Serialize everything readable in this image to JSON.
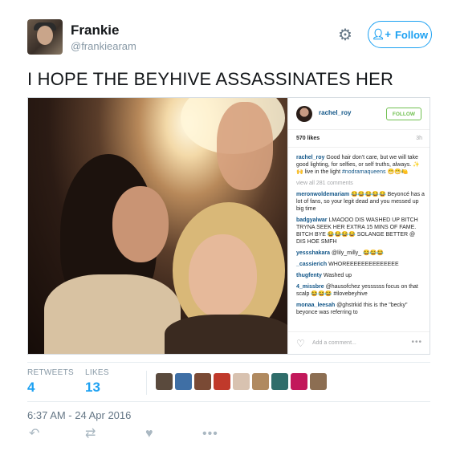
{
  "user": {
    "name": "Frankie",
    "handle": "@frankiearam"
  },
  "header": {
    "follow_label": "Follow",
    "gear_icon": "gear-icon",
    "follow_icon": "add-user-icon"
  },
  "tweet": {
    "text": "I HOPE THE BEYHIVE ASSASSINATES HER"
  },
  "instagram": {
    "username": "rachel_roy",
    "follow_label": "FOLLOW",
    "likes": "570 likes",
    "time": "3h",
    "caption_user": "rachel_roy",
    "caption_text": "Good hair don't care, but we will take good lighting, for selfies, or self truths, always. ✨🙌 live in the light",
    "caption_tag": "#nodramaqueens",
    "caption_emoji": "😁😁🍋",
    "view_all": "view all 281 comments",
    "comments": [
      {
        "user": "meronwoldemariam",
        "text": "😂😂😂😂😂 Beyoncé has a lot of fans, so your legit dead and you messed up big time"
      },
      {
        "user": "badgyalwar",
        "text": "LMAOOO DIS WASHED UP BITCH TRYNA SEEK HER EXTRA 15 MINS OF FAME. BITCH BYE 😂😂😂😂 SOLANGE BETTER @ DIS HOE SMFH"
      },
      {
        "user": "yessshakara",
        "text": "@lily_milly_ 😂😂😂"
      },
      {
        "user": "_cassierich",
        "text": "WHOREEEEEEEEEEEEEE"
      },
      {
        "user": "thugfenty",
        "text": "Washed up"
      },
      {
        "user": "4_missbre",
        "text": "@hausofchez yessssss focus on that scalp 😂😂😂 #ilovebeyhive"
      },
      {
        "user": "monaa_leesah",
        "text": "@ghstrkid this is the \"becky\" beyonce was referring to"
      }
    ],
    "add_comment": "Add a comment...",
    "more": "•••",
    "heart_icon": "heart-outline-icon"
  },
  "stats": {
    "retweets_label": "RETWEETS",
    "retweets_value": "4",
    "likes_label": "LIKES",
    "likes_value": "13",
    "liker_colors": [
      "#5a4a3d",
      "#3f6fa5",
      "#7a4a35",
      "#c0392b",
      "#d8c2b0",
      "#b08a60",
      "#2f6d6a",
      "#c2185b",
      "#8c6e52"
    ]
  },
  "timestamp": "6:37 AM - 24 Apr 2016",
  "actions": {
    "reply_icon": "reply-icon",
    "retweet_icon": "retweet-icon",
    "like_icon": "heart-icon",
    "more_icon": "more-icon",
    "more_text": "•••"
  }
}
